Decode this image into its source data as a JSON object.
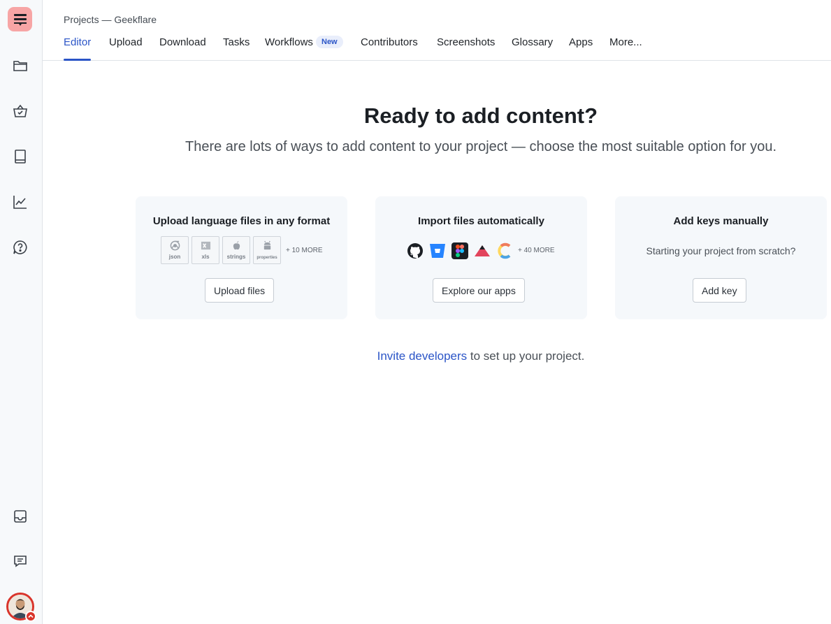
{
  "breadcrumb": "Projects — Geekflare",
  "tabs": [
    {
      "label": "Editor"
    },
    {
      "label": "Upload"
    },
    {
      "label": "Download"
    },
    {
      "label": "Tasks"
    },
    {
      "label": "Workflows"
    },
    {
      "label": "Contributors"
    },
    {
      "label": "Screenshots"
    },
    {
      "label": "Glossary"
    },
    {
      "label": "Apps"
    },
    {
      "label": "More..."
    }
  ],
  "workflows_badge": "New",
  "main": {
    "title": "Ready to add content?",
    "subtitle": "There are lots of ways to add content to your project — choose the most suitable option for you."
  },
  "cards": {
    "upload": {
      "title": "Upload language files in any format",
      "formats": [
        "json",
        "xls",
        "strings",
        "properties"
      ],
      "more": "+ 10 MORE",
      "button": "Upload files"
    },
    "import": {
      "title": "Import files automatically",
      "apps": [
        "github-icon",
        "bitbucket-icon",
        "figma-icon",
        "sketch-icon",
        "contentful-icon"
      ],
      "more": "+ 40 MORE",
      "button": "Explore our apps"
    },
    "manual": {
      "title": "Add keys manually",
      "text": "Starting your project from scratch?",
      "button": "Add key"
    }
  },
  "invite": {
    "link": "Invite developers",
    "rest": " to set up your project."
  },
  "colors": {
    "accent": "#2b55c7",
    "logo_bg": "#f7a5a5",
    "avatar_ring": "#d9342b"
  }
}
